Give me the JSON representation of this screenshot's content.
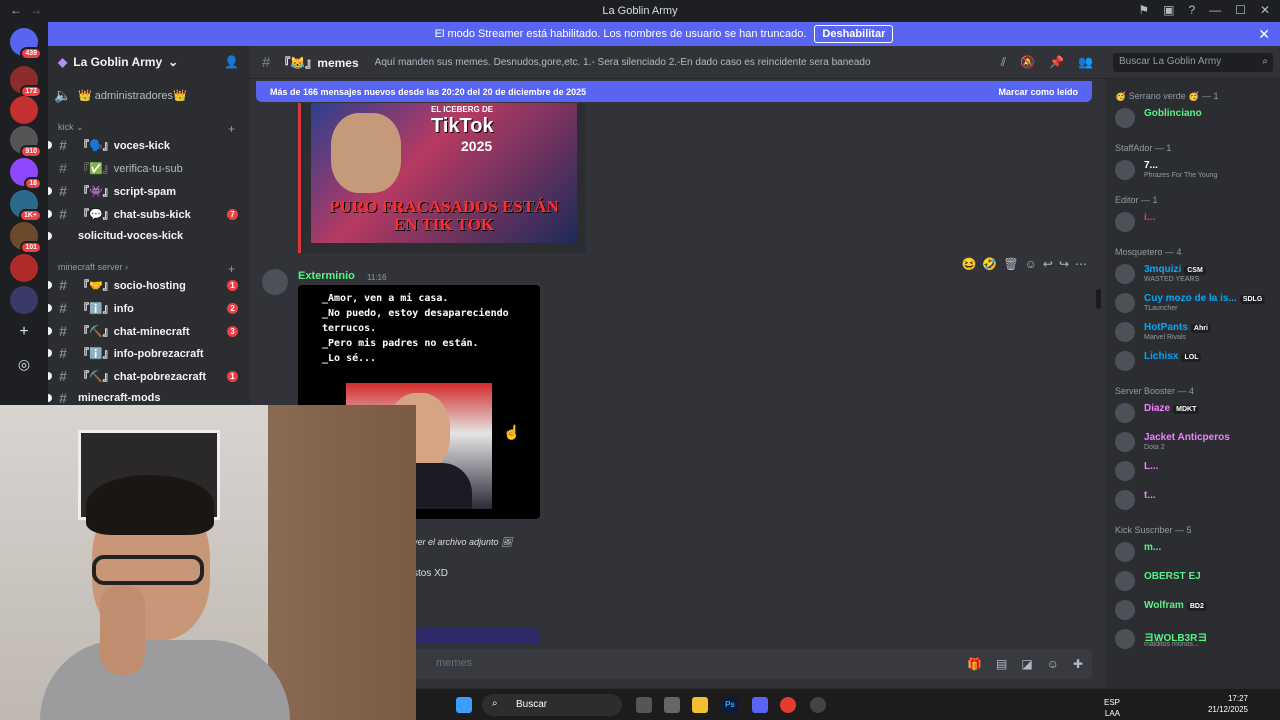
{
  "window": {
    "title": "La Goblin Army"
  },
  "banner": {
    "text": "El modo Streamer está habilitado. Los nombres de usuario se han truncado.",
    "button": "Deshabilitar"
  },
  "guilds": [
    {
      "badge": "439"
    },
    {
      "badge": "172"
    },
    {
      "badge": ""
    },
    {
      "badge": "910"
    },
    {
      "badge": "18"
    },
    {
      "badge": "1K+"
    },
    {
      "badge": "101"
    },
    {
      "badge": ""
    },
    {
      "badge": ""
    }
  ],
  "server": {
    "name": "La Goblin Army"
  },
  "channels": {
    "top": "👑 administradores👑",
    "cat_kick": "kick",
    "cat_minecraft": "minecraft server",
    "items": [
      {
        "label": "『🗣️』voces-kick",
        "badge": ""
      },
      {
        "label": "『✅』verifica-tu-sub",
        "badge": ""
      },
      {
        "label": "『👾』script-spam",
        "badge": ""
      },
      {
        "label": "『💬』chat-subs-kick",
        "badge": "7"
      },
      {
        "label": "solicitud-voces-kick",
        "badge": ""
      },
      {
        "label": "『🤝』socio-hosting",
        "badge": "1"
      },
      {
        "label": "『ℹ️』info",
        "badge": "2"
      },
      {
        "label": "『⛏️』chat-minecraft",
        "badge": "3"
      },
      {
        "label": "『ℹ️』info-pobrezacraft",
        "badge": ""
      },
      {
        "label": "『⛏️』chat-pobrezacraft",
        "badge": "1"
      },
      {
        "label": "minecraft-mods",
        "badge": ""
      }
    ]
  },
  "header": {
    "channel": "『😹』memes",
    "topic": "Aquí manden sus memes. Desnudos,gore,etc. 1.- Sera silenciado 2.-En dado caso es reincidente sera baneado",
    "search_placeholder": "Buscar La Goblin Army"
  },
  "newbar": {
    "text": "Más de 166 mensajes nuevos desde las 20:20 del 20 de diciembre de 2025",
    "action": "Marcar como leído"
  },
  "messages": {
    "meme1": {
      "line1": "EL ICEBERG DE",
      "line2": "TikTok",
      "line3": "2025",
      "caption": "PURO FRACASADOS ESTÁN EN TIK TOK"
    },
    "msg2": {
      "author": "Exterminio",
      "time": "11:16",
      "meme_text": "_Amor, ven a mi casa.\n_No puedo, estoy desapareciendo\nterrucos.\n_Pero mis padres no están.\n_Lo sé..."
    },
    "attachment": "ver el archivo adjunto",
    "fragment": "stos XD"
  },
  "composer": {
    "placeholder": "memes"
  },
  "members": [
    {
      "role": "🥳 Serrano verde 🥳 — 1",
      "list": [
        {
          "name": "Goblinciano",
          "sub": "",
          "color": "#57f287",
          "tag": ""
        }
      ]
    },
    {
      "role": "StaffAdor — 1",
      "list": [
        {
          "name": "7...",
          "sub": "Phrazes For The Young",
          "color": "#ffffff",
          "tag": ""
        }
      ]
    },
    {
      "role": "Editor — 1",
      "list": [
        {
          "name": "i...",
          "sub": "",
          "color": "#f23f43",
          "tag": ""
        }
      ]
    },
    {
      "role": "Mosquetero — 4",
      "list": [
        {
          "name": "3mquizi",
          "sub": "WASTED YEARS",
          "color": "#00a8fc",
          "tag": "CSM"
        },
        {
          "name": "Cuy mozo de la is...",
          "sub": "TLauncher",
          "color": "#00a8fc",
          "tag": "SDLG"
        },
        {
          "name": "HotPants",
          "sub": "Marvel Rivals",
          "color": "#00a8fc",
          "tag": "Ahri"
        },
        {
          "name": "Lichisx",
          "sub": "",
          "color": "#00a8fc",
          "tag": "LOL"
        }
      ]
    },
    {
      "role": "Server Booster — 4",
      "list": [
        {
          "name": "Diaze",
          "sub": "",
          "color": "#f47fff",
          "tag": "MDKT"
        },
        {
          "name": "Jacket Anticperos",
          "sub": "Dota 2",
          "color": "#f47fff",
          "tag": ""
        },
        {
          "name": "L...",
          "sub": "",
          "color": "#f47fff",
          "tag": ""
        },
        {
          "name": "t...",
          "sub": "",
          "color": "#f47fff",
          "tag": ""
        }
      ]
    },
    {
      "role": "Kick Suscriber — 5",
      "list": [
        {
          "name": "m...",
          "sub": "",
          "color": "#57f287",
          "tag": ""
        },
        {
          "name": "OBERST EJ",
          "sub": "",
          "color": "#57f287",
          "tag": ""
        },
        {
          "name": "Wolfram",
          "sub": "",
          "color": "#57f287",
          "tag": "BD2"
        },
        {
          "name": "ヨWOLB3Rヨ",
          "sub": "malditos monos...",
          "color": "#57f287",
          "tag": ""
        }
      ]
    }
  ],
  "taskbar": {
    "search": "Buscar",
    "lang": "ESP",
    "lang2": "LAA",
    "time": "17:27",
    "date": "21/12/2025"
  },
  "colors": {
    "blurple": "#5865f2",
    "green": "#57f287",
    "red": "#f23f43"
  }
}
